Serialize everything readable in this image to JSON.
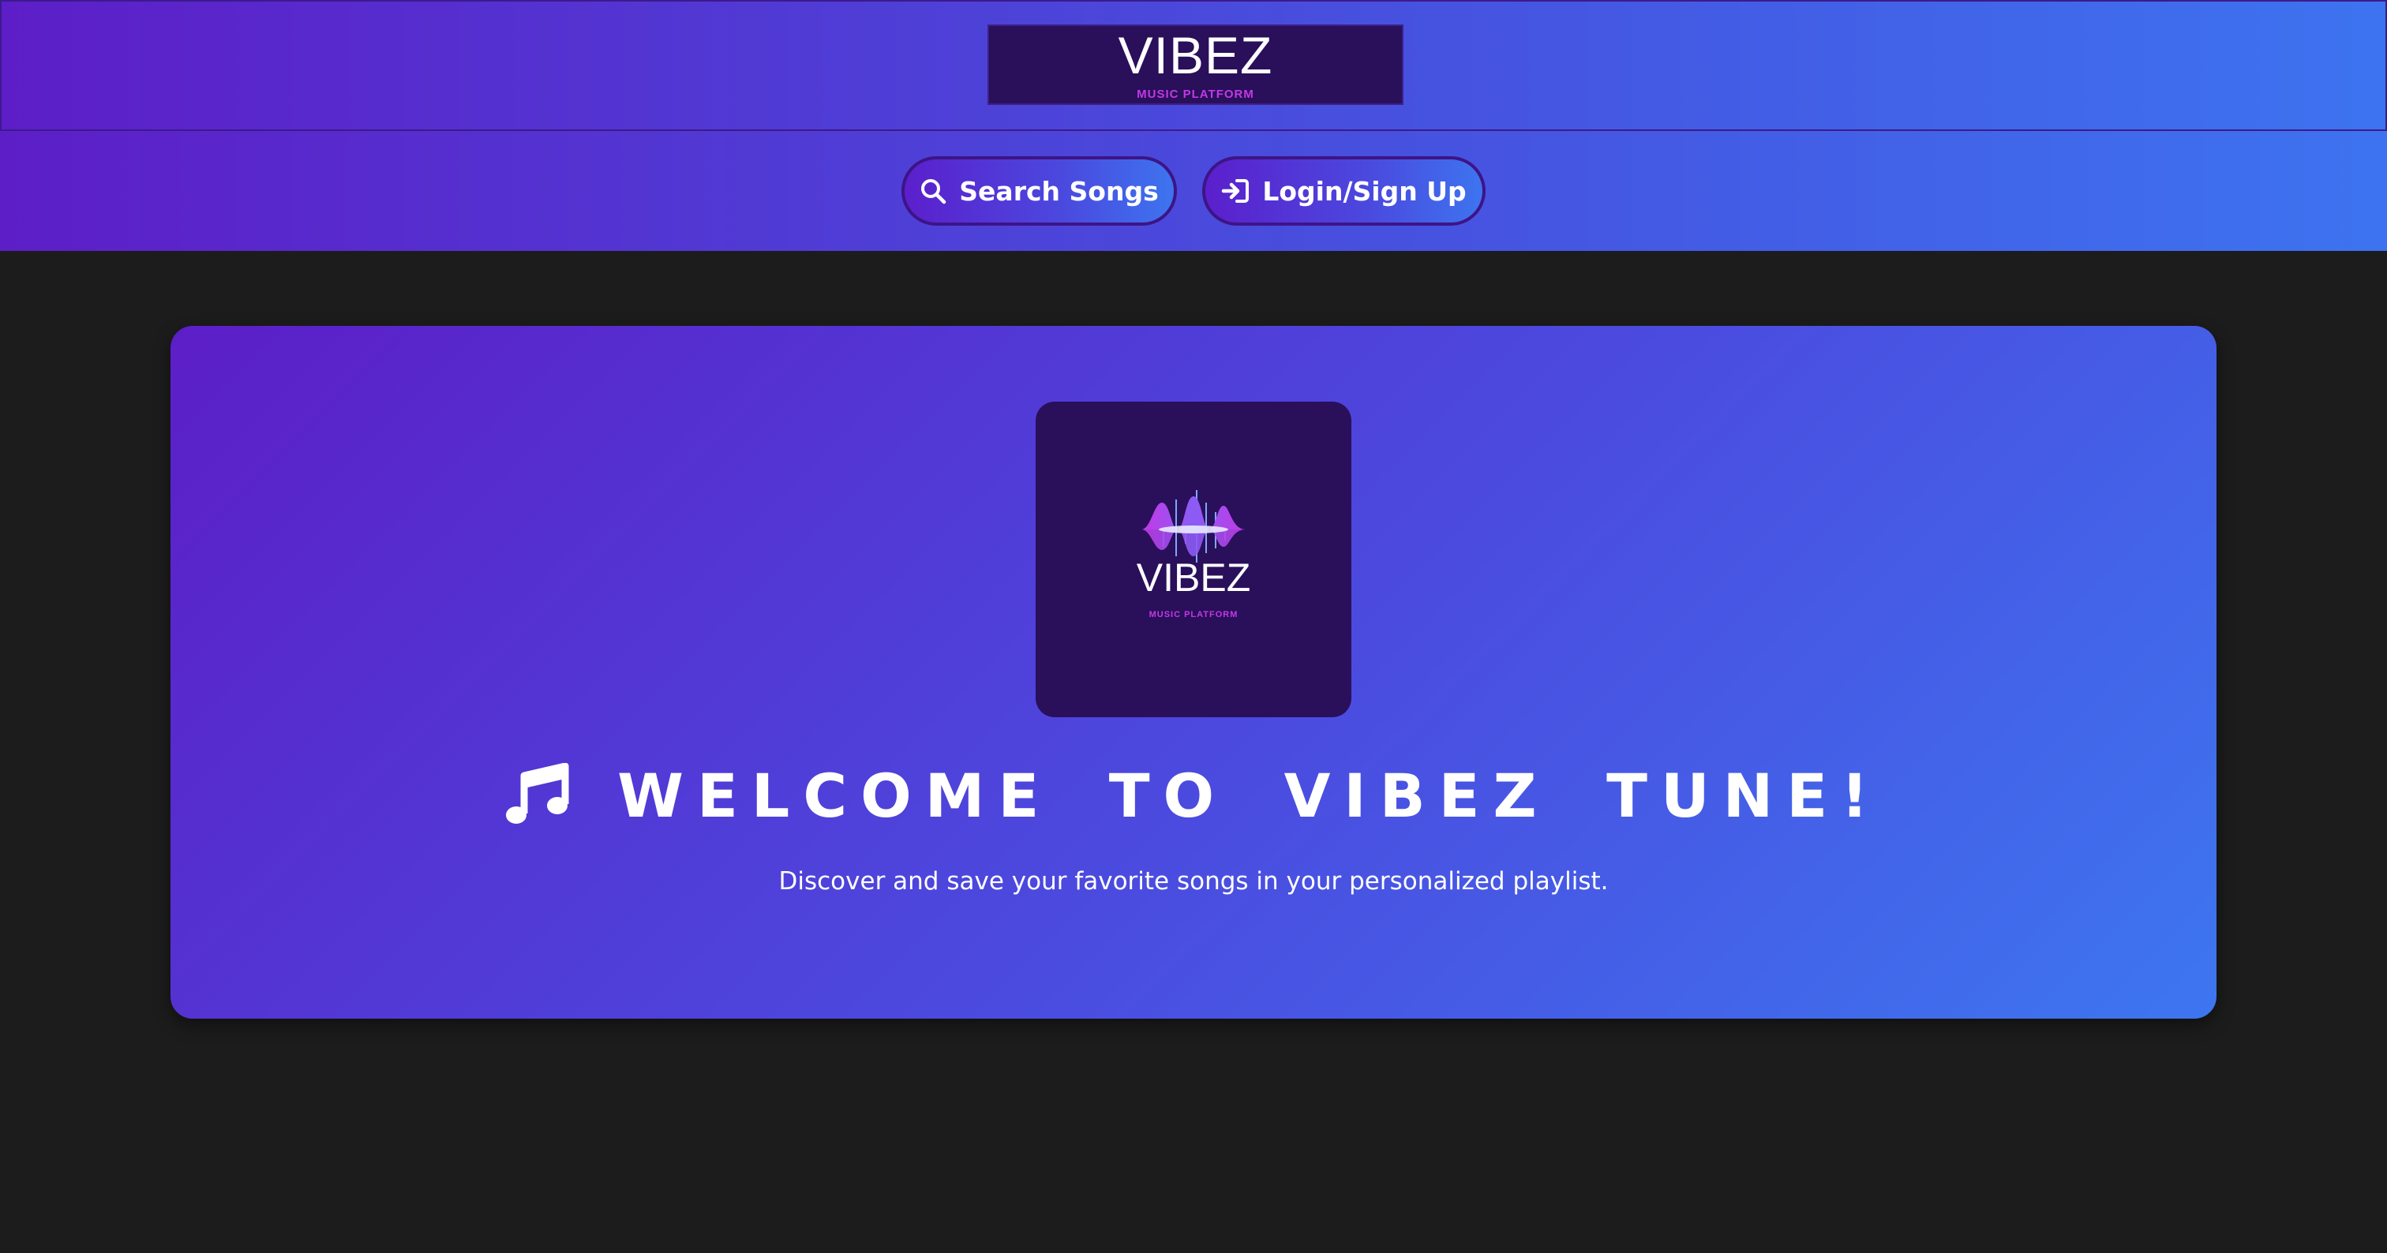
{
  "header": {
    "brand_title": "VIBEZ",
    "brand_subtitle": "MUSIC PLATFORM"
  },
  "nav": {
    "search_label": "Search Songs",
    "search_icon": "search-icon",
    "login_label": "Login/Sign Up",
    "login_icon": "sign-in-icon"
  },
  "hero": {
    "logo_title": "VIBEZ",
    "logo_subtitle": "MUSIC PLATFORM",
    "heading_icon": "music-note-icon",
    "heading": "WELCOME TO VIBEZ TUNE!",
    "description": "Discover and save your favorite songs in your personalized playlist."
  },
  "colors": {
    "gradient_start": "#5d1ec7",
    "gradient_end": "#3d73f0",
    "page_background": "#1c1c1c",
    "logo_background": "#2a0f5b",
    "logo_accent": "#c239e4"
  }
}
